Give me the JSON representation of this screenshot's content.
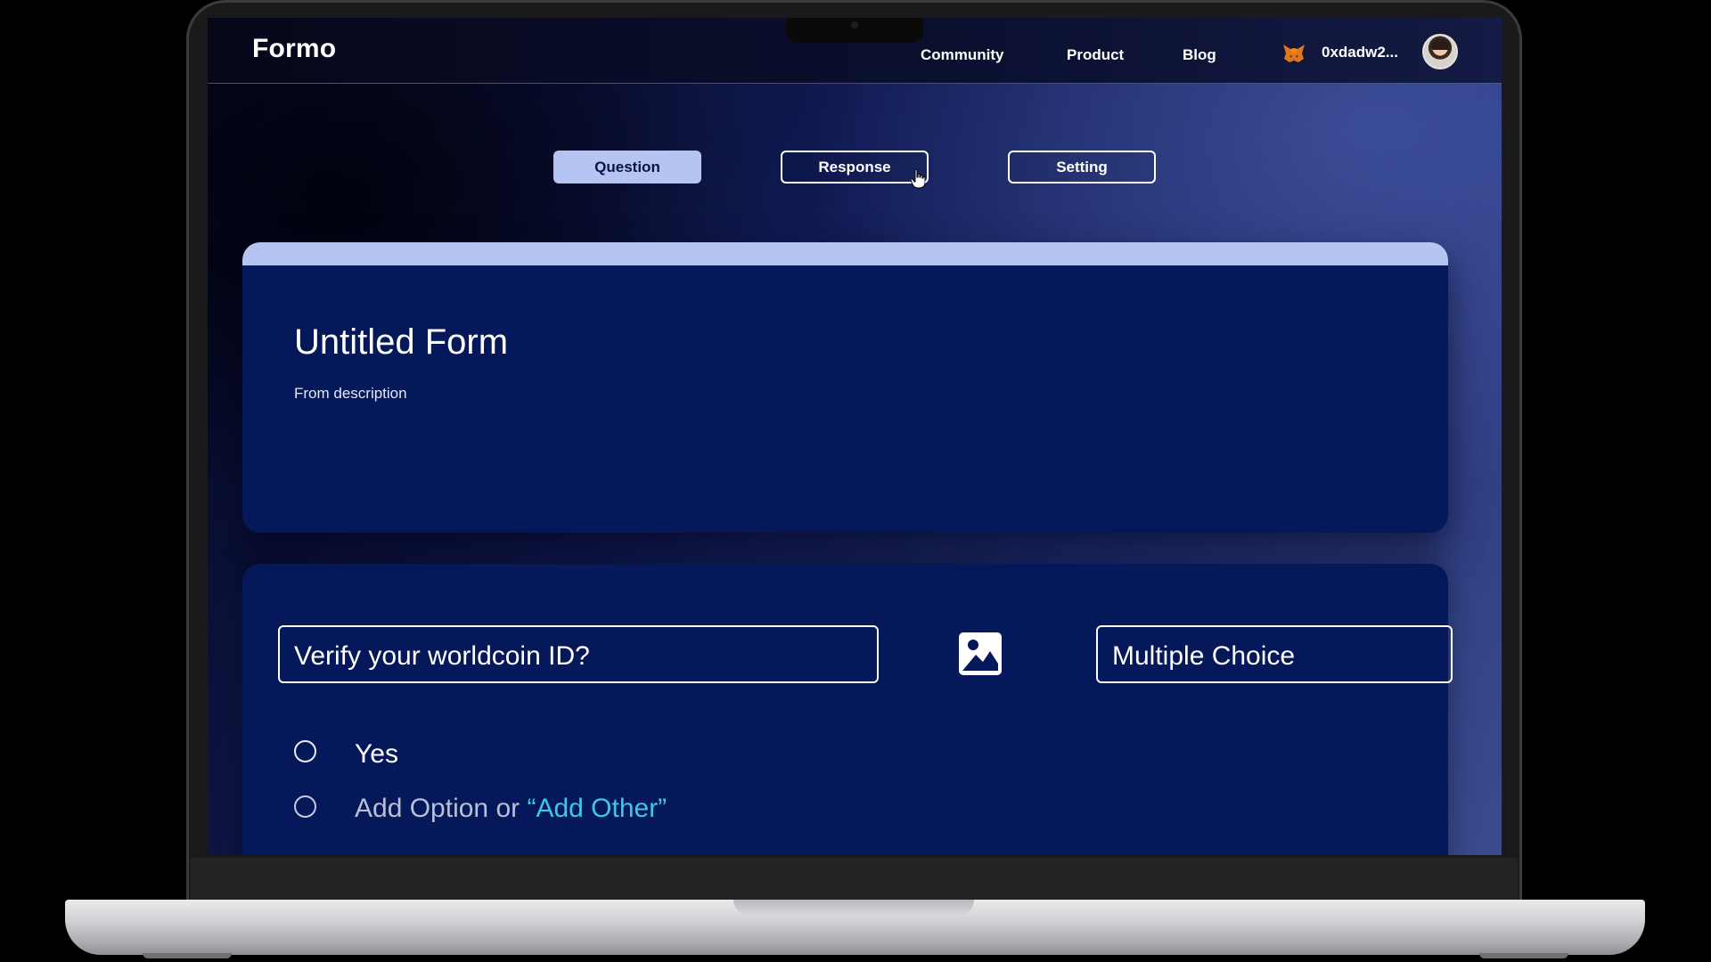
{
  "navbar": {
    "brand": "Formo",
    "links": [
      "Community",
      "Product",
      "Blog"
    ],
    "wallet_address": "0xdadw2...",
    "wallet_icon": "metamask-fox-icon",
    "avatar_icon": "user-avatar"
  },
  "tabs": [
    {
      "label": "Question",
      "active": true
    },
    {
      "label": "Response",
      "active": false
    },
    {
      "label": "Setting",
      "active": false
    }
  ],
  "form": {
    "title": "Untitled Form",
    "description": "From description"
  },
  "question": {
    "text": "Verify your worldcoin ID?",
    "type": "Multiple Choice",
    "image_icon": "image-icon",
    "options": [
      {
        "label": "Yes"
      }
    ],
    "add_option_prefix": "Add Option or ",
    "add_other_label": "“Add Other”"
  },
  "colors": {
    "accent": "#b6c4f1",
    "card_background": "#04185a",
    "add_other": "#3fc6e9"
  }
}
